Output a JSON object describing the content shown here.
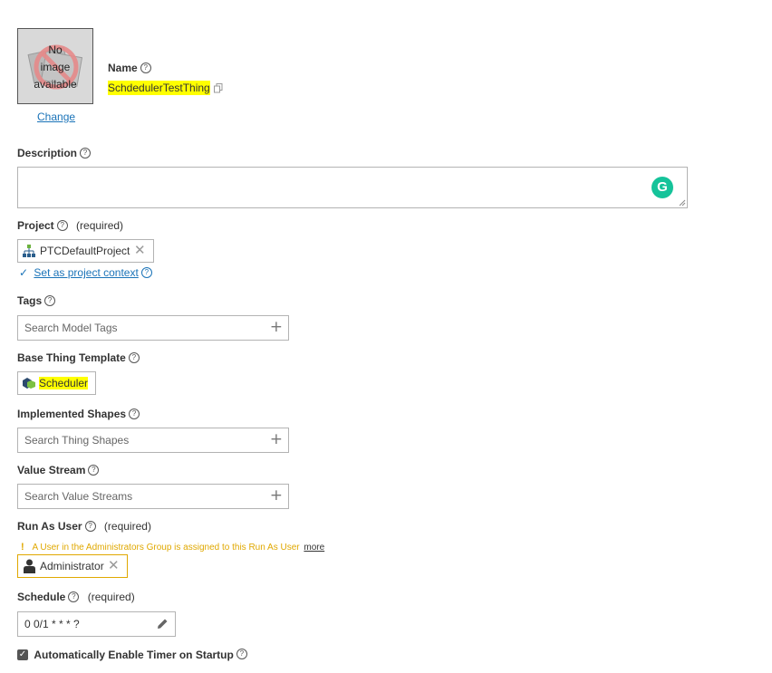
{
  "image": {
    "line1": "No",
    "line2": "image",
    "line3": "available",
    "change_link": "Change"
  },
  "name": {
    "label": "Name",
    "value": "SchdedulerTestThing"
  },
  "description": {
    "label": "Description",
    "value": ""
  },
  "project": {
    "label": "Project",
    "required": "(required)",
    "value": "PTCDefaultProject",
    "context_link": "Set as project context"
  },
  "tags": {
    "label": "Tags",
    "placeholder": "Search Model Tags"
  },
  "base_template": {
    "label": "Base Thing Template",
    "value": "Scheduler"
  },
  "shapes": {
    "label": "Implemented Shapes",
    "placeholder": "Search Thing Shapes"
  },
  "value_stream": {
    "label": "Value Stream",
    "placeholder": "Search Value Streams"
  },
  "run_as_user": {
    "label": "Run As User",
    "required": "(required)",
    "warning": "A User in the Administrators Group is assigned to this Run As User",
    "more_link": "more",
    "value": "Administrator"
  },
  "schedule": {
    "label": "Schedule",
    "required": "(required)",
    "value": "0 0/1 * * * ?"
  },
  "auto_timer": {
    "label": "Automatically Enable Timer on Startup",
    "checked": true
  },
  "colors": {
    "accent": "#1a73b8",
    "highlight": "#ffff00",
    "warning": "#e0a800",
    "grammarly": "#15c39a"
  }
}
